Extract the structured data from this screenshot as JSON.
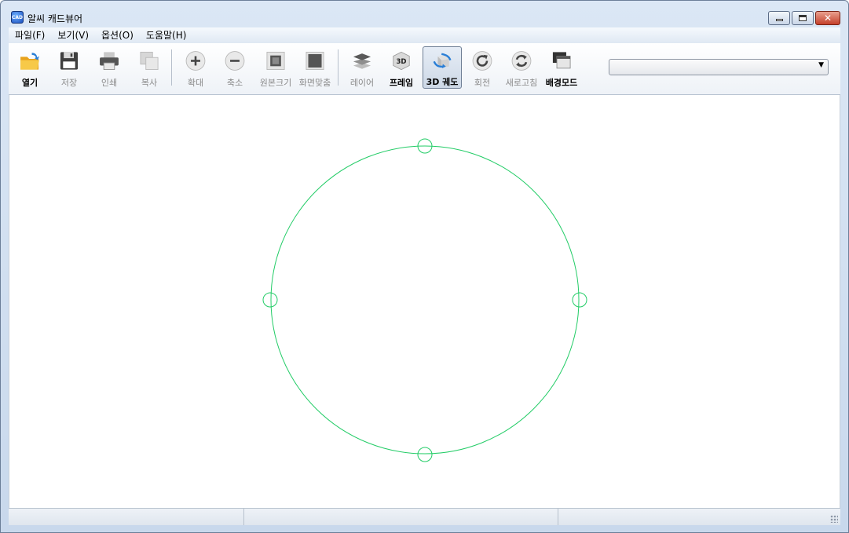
{
  "window": {
    "title": "알씨 캐드뷰어",
    "app_icon": "CAD"
  },
  "menu": [
    "파일(F)",
    "보기(V)",
    "옵션(O)",
    "도움말(H)"
  ],
  "toolbar": {
    "buttons": [
      {
        "label": "열기",
        "icon": "folder-open-icon",
        "enabled": true
      },
      {
        "label": "저장",
        "icon": "floppy-disk-icon",
        "enabled": false
      },
      {
        "label": "인쇄",
        "icon": "printer-icon",
        "enabled": false
      },
      {
        "label": "복사",
        "icon": "copy-icon",
        "enabled": false
      },
      {
        "label": "확대",
        "icon": "zoom-in-icon",
        "enabled": false
      },
      {
        "label": "축소",
        "icon": "zoom-out-icon",
        "enabled": false
      },
      {
        "label": "원본크기",
        "icon": "actual-size-icon",
        "enabled": false
      },
      {
        "label": "화면맞춤",
        "icon": "fit-screen-icon",
        "enabled": false
      },
      {
        "label": "레이어",
        "icon": "layers-icon",
        "enabled": false
      },
      {
        "label": "프레임",
        "icon": "3d-frame-icon",
        "enabled": true
      },
      {
        "label": "3D 궤도",
        "icon": "3d-orbit-icon",
        "enabled": true,
        "pressed": true
      },
      {
        "label": "회전",
        "icon": "rotate-icon",
        "enabled": false
      },
      {
        "label": "새로고침",
        "icon": "refresh-icon",
        "enabled": false
      },
      {
        "label": "배경모드",
        "icon": "background-mode-icon",
        "enabled": true
      }
    ],
    "dropdown_value": ""
  },
  "drawing": {
    "color": "#22cc66",
    "shape": "circle with four grip markers"
  },
  "status": {
    "pane1": "",
    "pane2": "",
    "pane3": ""
  }
}
